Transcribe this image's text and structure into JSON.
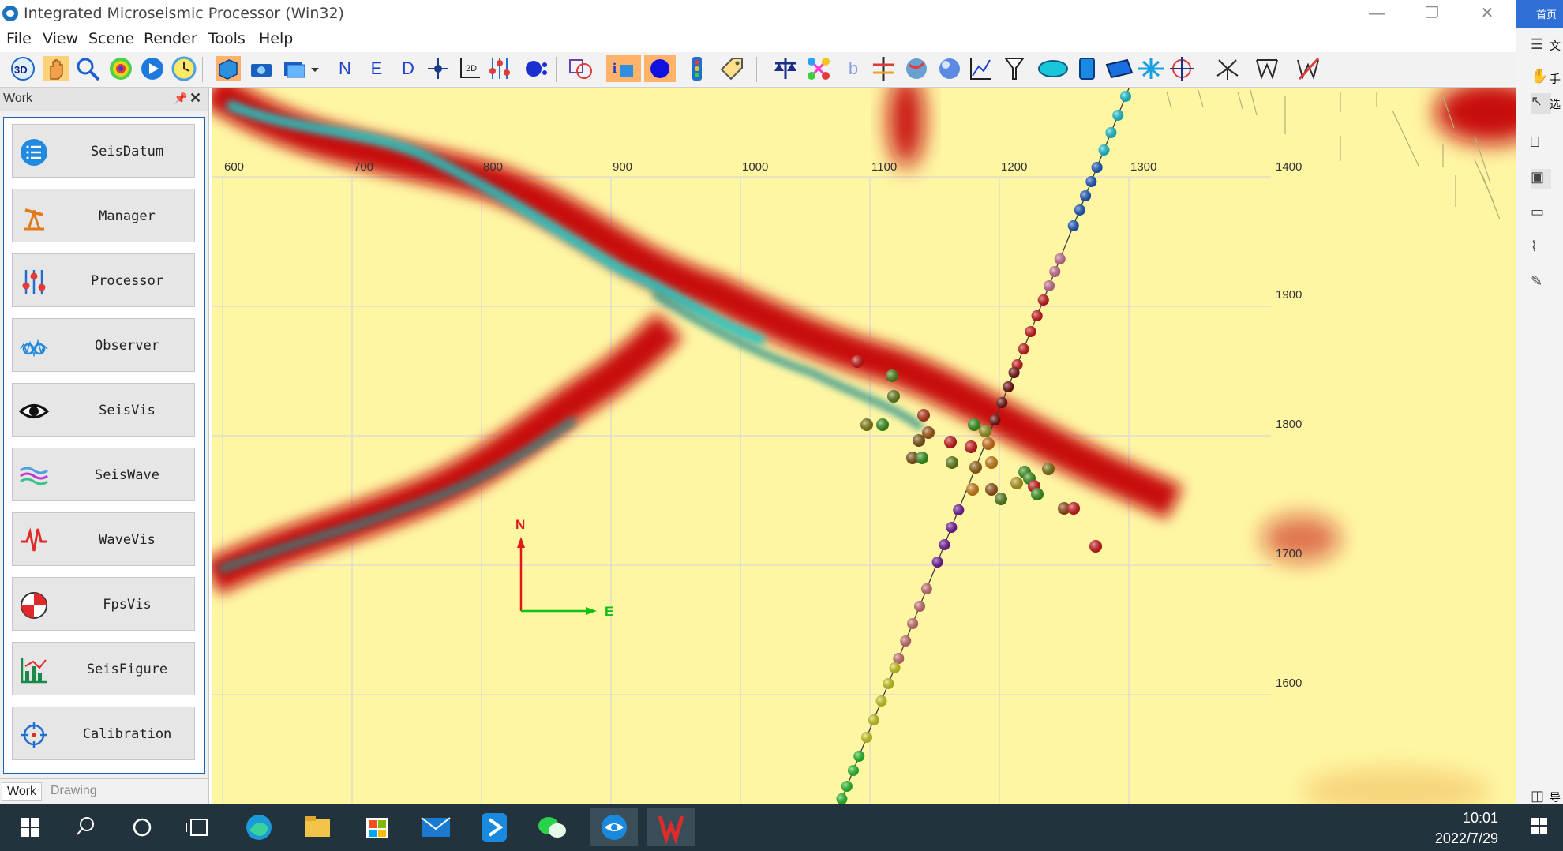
{
  "window": {
    "title": "Integrated Microseismic Processor (Win32)",
    "controls": [
      "—",
      "❐",
      "✕"
    ],
    "home_tab": "首页"
  },
  "menu": [
    "File",
    "View",
    "Scene",
    "Render",
    "Tools",
    "Help"
  ],
  "toolbar": {
    "icons": [
      "3d-view-icon",
      "pan-hand-icon",
      "zoom-icon",
      "color-sphere-icon",
      "play-icon",
      "clock-icon",
      "cube-icon",
      "camera-icon",
      "image-export-icon",
      "dropdown-icon",
      "north-axis-icon",
      "east-axis-icon",
      "down-axis-icon",
      "crosshair-icon",
      "2d-axis-icon",
      "sliders-icon",
      "particle-icon",
      "shapes-icon",
      "info-icon",
      "circle-fill-icon",
      "traffic-light-icon",
      "tag-icon",
      "balance-icon",
      "network-icon",
      "b-value-icon",
      "well-icon",
      "globe-icon",
      "sphere-icon",
      "graph-icon",
      "filter-icon",
      "ellipse-icon",
      "cylinder-icon",
      "plane-icon",
      "aircraft-icon",
      "target-icon",
      "fan-icon",
      "w-icon",
      "w-strike-icon"
    ],
    "letters": {
      "n": "N",
      "e": "E",
      "d": "D",
      "b": "b"
    }
  },
  "work_panel": {
    "title": "Work",
    "items": [
      {
        "label": "SeisDatum",
        "icon": "list-icon"
      },
      {
        "label": "Manager",
        "icon": "oil-pump-icon"
      },
      {
        "label": "Processor",
        "icon": "sliders-icon"
      },
      {
        "label": "Observer",
        "icon": "observer-icon"
      },
      {
        "label": "SeisVis",
        "icon": "eye-icon"
      },
      {
        "label": "SeisWave",
        "icon": "wave-icon"
      },
      {
        "label": "WaveVis",
        "icon": "pulse-icon"
      },
      {
        "label": "FpsVis",
        "icon": "beachball-icon"
      },
      {
        "label": "SeisFigure",
        "icon": "bar-chart-icon"
      },
      {
        "label": "Calibration",
        "icon": "crosshair-icon"
      }
    ],
    "tabs": [
      "Work",
      "Drawing"
    ]
  },
  "viewport": {
    "x_ticks": [
      "600",
      "700",
      "800",
      "900",
      "1000",
      "1100",
      "1200",
      "1300",
      "1400"
    ],
    "y_ticks": [
      "1900",
      "1800",
      "1700",
      "1600"
    ],
    "compass": {
      "north": "N",
      "east": "E"
    },
    "background_color": "#fff6a4",
    "anomaly_color": "#c80e0e",
    "anomaly_core_color": "#1fc8c8"
  },
  "right_bar": {
    "items": [
      {
        "icon": "menu-icon",
        "label": "文"
      },
      {
        "icon": "hand-icon",
        "label": "手"
      },
      {
        "icon": "cursor-icon",
        "label": "选"
      },
      {
        "icon": "bookmark-icon",
        "label": ""
      },
      {
        "icon": "image-icon",
        "label": ""
      },
      {
        "icon": "comment-icon",
        "label": ""
      },
      {
        "icon": "attach-icon",
        "label": ""
      },
      {
        "icon": "sign-icon",
        "label": ""
      },
      {
        "icon": "nav-icon",
        "label": "导"
      }
    ]
  },
  "taskbar": {
    "icons": [
      "windows-start-icon",
      "search-icon",
      "cortana-icon",
      "task-view-icon",
      "edge-icon",
      "explorer-icon",
      "store-icon",
      "mail-icon",
      "feishu-icon",
      "wechat-icon",
      "seisvis-app-icon",
      "wps-icon"
    ],
    "time": "10:01",
    "date": "2022/7/29"
  }
}
